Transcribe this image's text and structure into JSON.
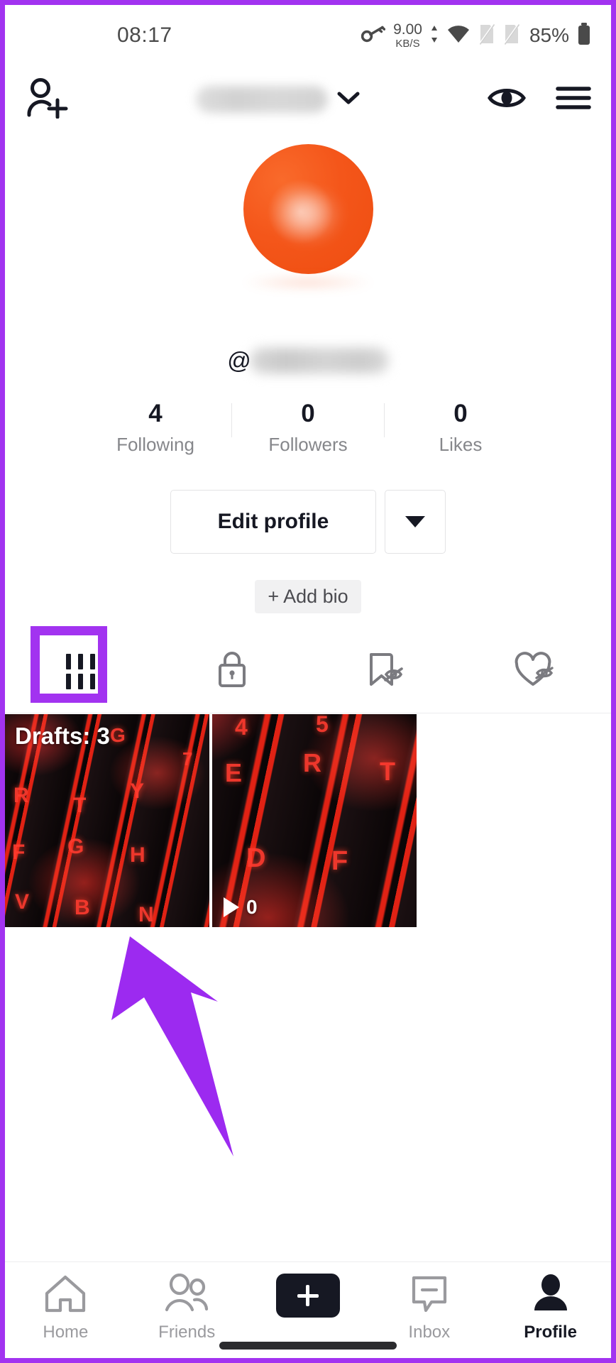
{
  "status_bar": {
    "time": "08:17",
    "key_icon": "key-icon",
    "network_speed_value": "9.00",
    "network_speed_unit": "KB/S",
    "wifi_icon": "wifi-icon",
    "sim1_icon": "sim-disabled-icon",
    "sim2_icon": "sim-disabled-icon",
    "battery_percent": "85%",
    "battery_icon": "battery-icon"
  },
  "header": {
    "add_friend_icon": "add-person-icon",
    "username_masked": "",
    "chevron_icon": "chevron-down-icon",
    "views_icon": "eye-icon",
    "menu_icon": "hamburger-menu-icon"
  },
  "profile": {
    "avatar_icon": "avatar-image",
    "avatar_color": "#F4561A",
    "handle_prefix": "@",
    "handle_masked": "",
    "stats": [
      {
        "value": "4",
        "label": "Following",
        "name": "following"
      },
      {
        "value": "0",
        "label": "Followers",
        "name": "followers"
      },
      {
        "value": "0",
        "label": "Likes",
        "name": "likes"
      }
    ],
    "edit_profile_label": "Edit profile",
    "dropdown_icon": "triangle-down-icon",
    "add_bio_label": "+ Add bio"
  },
  "tabs": [
    {
      "name": "posts",
      "icon": "grid-posts-icon",
      "active": true
    },
    {
      "name": "private",
      "icon": "lock-icon",
      "active": false
    },
    {
      "name": "saved",
      "icon": "bookmark-hidden-icon",
      "active": false
    },
    {
      "name": "liked",
      "icon": "heart-hidden-icon",
      "active": false
    }
  ],
  "videos": [
    {
      "name": "drafts-tile",
      "overlay_label": "Drafts: 3",
      "play_count": null,
      "play_icon": null
    },
    {
      "name": "video-tile",
      "overlay_label": null,
      "play_count": "0",
      "play_icon": "play-icon"
    }
  ],
  "annotations": {
    "highlight_color": "#A233F0",
    "arrow_color": "#9C2AF0",
    "highlight_target": "posts-tab",
    "arrow_target": "drafts-tile"
  },
  "bottom_nav": [
    {
      "label": "Home",
      "icon": "home-icon",
      "name": "home",
      "active": false
    },
    {
      "label": "Friends",
      "icon": "friends-icon",
      "name": "friends",
      "active": false
    },
    {
      "label": "",
      "icon": "create-plus-icon",
      "name": "create",
      "active": false
    },
    {
      "label": "Inbox",
      "icon": "inbox-icon",
      "name": "inbox",
      "active": false
    },
    {
      "label": "Profile",
      "icon": "person-icon",
      "name": "profile",
      "active": true
    }
  ]
}
